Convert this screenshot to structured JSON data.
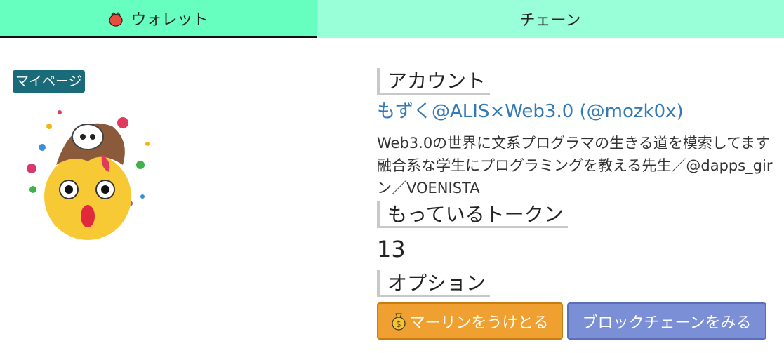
{
  "tabs": {
    "wallet_label": "ウォレット",
    "wallet_icon": "wallet-icon",
    "chain_label": "チェーン"
  },
  "mypage": {
    "badge_label": "マイページ",
    "avatar_icon": "surprised-emoji-avatar"
  },
  "account": {
    "heading": "アカウント",
    "name": "もずく@ALIS×Web3.0 (@mozk0x)",
    "bio_lines": [
      "Web3.0の世界に文系プログラマの生きる道を模索してます",
      "融合系な学生にプログラミングを教える先生／@dapps_gir",
      "ン／VOENISTA"
    ]
  },
  "tokens": {
    "heading": "もっているトークン",
    "count": "13"
  },
  "options": {
    "heading": "オプション",
    "marine_button": "マーリンをうけとる",
    "marine_icon": "money-bag-icon",
    "chain_button": "ブロックチェーンをみる"
  },
  "colors": {
    "tab_active": "#66ffbf",
    "tab_inactive": "#99ffd9",
    "badge": "#1a6b7a",
    "link": "#337ab7",
    "btn_orange": "#f0a030",
    "btn_blue": "#7b8fd6"
  }
}
